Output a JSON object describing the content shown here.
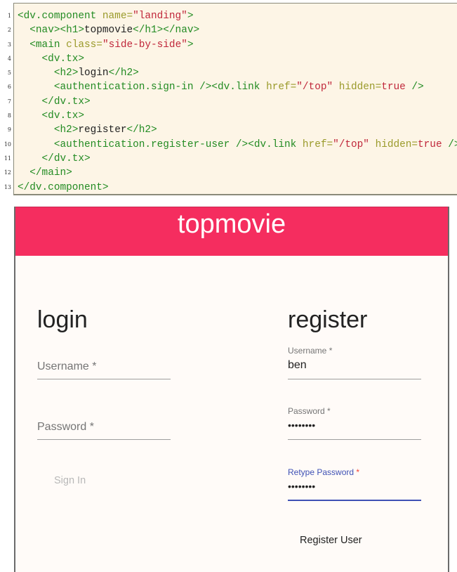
{
  "code_listing": {
    "line_numbers": [
      "1",
      "2",
      "3",
      "4",
      "5",
      "6",
      "7",
      "8",
      "9",
      "10",
      "11",
      "12",
      "13"
    ],
    "lines": [
      [
        {
          "t": "tag",
          "v": "<dv.component "
        },
        {
          "t": "attr",
          "v": "name="
        },
        {
          "t": "str",
          "v": "\"landing\""
        },
        {
          "t": "tag",
          "v": ">"
        }
      ],
      [
        {
          "t": "plain",
          "v": "  "
        },
        {
          "t": "tag",
          "v": "<nav><h1>"
        },
        {
          "t": "plain",
          "v": "topmovie"
        },
        {
          "t": "tag",
          "v": "</h1></nav>"
        }
      ],
      [
        {
          "t": "plain",
          "v": "  "
        },
        {
          "t": "tag",
          "v": "<main "
        },
        {
          "t": "attr",
          "v": "class="
        },
        {
          "t": "str",
          "v": "\"side-by-side\""
        },
        {
          "t": "tag",
          "v": ">"
        }
      ],
      [
        {
          "t": "plain",
          "v": "    "
        },
        {
          "t": "tag",
          "v": "<dv.tx>"
        }
      ],
      [
        {
          "t": "plain",
          "v": "      "
        },
        {
          "t": "tag",
          "v": "<h2>"
        },
        {
          "t": "plain",
          "v": "login"
        },
        {
          "t": "tag",
          "v": "</h2>"
        }
      ],
      [
        {
          "t": "plain",
          "v": "      "
        },
        {
          "t": "tag",
          "v": "<authentication.sign-in />"
        },
        {
          "t": "tag",
          "v": "<dv.link "
        },
        {
          "t": "attr",
          "v": "href="
        },
        {
          "t": "str",
          "v": "\"/top\""
        },
        {
          "t": "plain",
          "v": " "
        },
        {
          "t": "attr",
          "v": "hidden="
        },
        {
          "t": "bool",
          "v": "true"
        },
        {
          "t": "tag",
          "v": " />"
        }
      ],
      [
        {
          "t": "plain",
          "v": "    "
        },
        {
          "t": "tag",
          "v": "</dv.tx>"
        }
      ],
      [
        {
          "t": "plain",
          "v": "    "
        },
        {
          "t": "tag",
          "v": "<dv.tx>"
        }
      ],
      [
        {
          "t": "plain",
          "v": "      "
        },
        {
          "t": "tag",
          "v": "<h2>"
        },
        {
          "t": "plain",
          "v": "register"
        },
        {
          "t": "tag",
          "v": "</h2>"
        }
      ],
      [
        {
          "t": "plain",
          "v": "      "
        },
        {
          "t": "tag",
          "v": "<authentication.register-user />"
        },
        {
          "t": "tag",
          "v": "<dv.link "
        },
        {
          "t": "attr",
          "v": "href="
        },
        {
          "t": "str",
          "v": "\"/top\""
        },
        {
          "t": "plain",
          "v": " "
        },
        {
          "t": "attr",
          "v": "hidden="
        },
        {
          "t": "bool",
          "v": "true"
        },
        {
          "t": "tag",
          "v": " />"
        }
      ],
      [
        {
          "t": "plain",
          "v": "    "
        },
        {
          "t": "tag",
          "v": "</dv.tx>"
        }
      ],
      [
        {
          "t": "plain",
          "v": "  "
        },
        {
          "t": "tag",
          "v": "</main>"
        }
      ],
      [
        {
          "t": "tag",
          "v": "</dv.component>"
        }
      ]
    ]
  },
  "app": {
    "title": "topmovie",
    "brand_color": "#f52d5f",
    "accent_color": "#3f51b5",
    "login": {
      "heading": "login",
      "username_label": "Username *",
      "username_value": "",
      "password_label": "Password *",
      "password_value": "",
      "submit_label": "Sign In",
      "submit_disabled": true
    },
    "register": {
      "heading": "register",
      "username_label": "Username *",
      "username_value": "ben",
      "password_label": "Password *",
      "password_value": "••••••••",
      "retype_label": "Retype Password",
      "retype_required_marker": "*",
      "retype_value": "••••••••",
      "retype_focused": true,
      "submit_label": "Register User"
    }
  }
}
